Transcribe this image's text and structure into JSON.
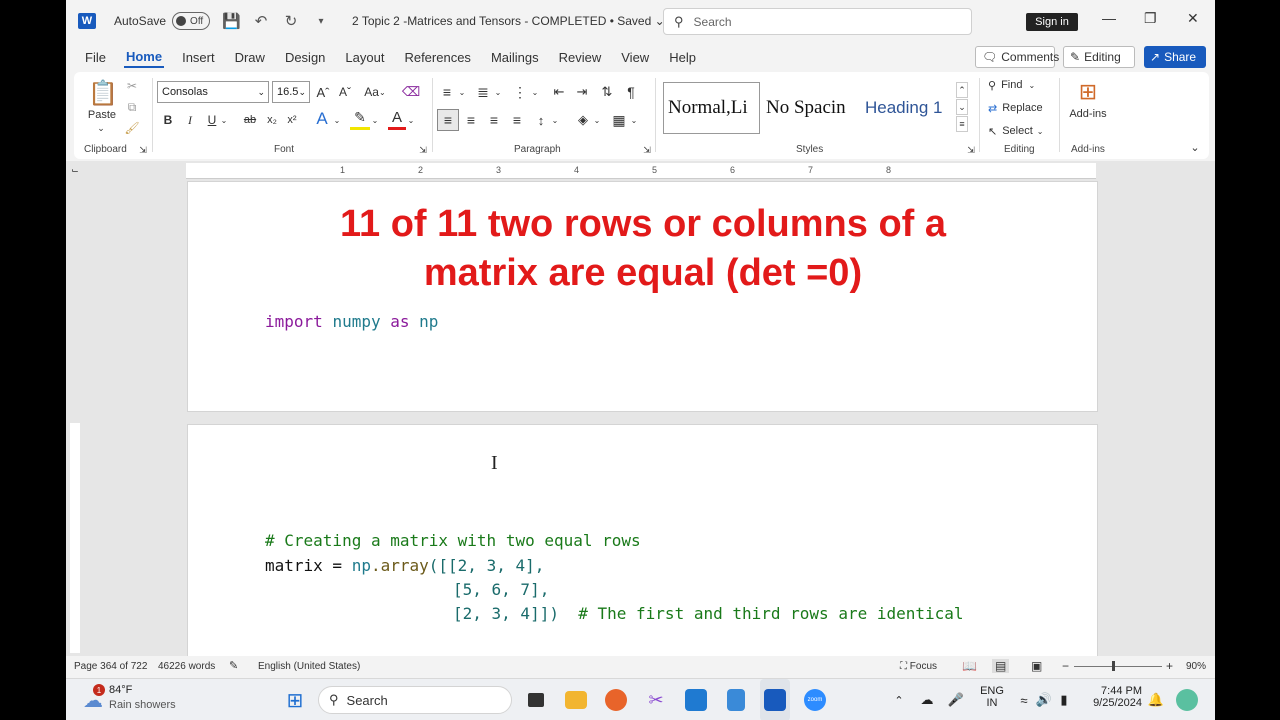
{
  "titlebar": {
    "app_logo": "W",
    "autosave_label": "AutoSave",
    "autosave_state": "Off",
    "doc_title": "2 Topic 2 -Matrices and Tensors - COMPLETED • Saved",
    "search_placeholder": "Search",
    "signin_label": "Sign in"
  },
  "menu": {
    "items": [
      "File",
      "Home",
      "Insert",
      "Draw",
      "Design",
      "Layout",
      "References",
      "Mailings",
      "Review",
      "View",
      "Help"
    ],
    "comments_label": "Comments",
    "editing_label": "Editing",
    "share_label": "Share"
  },
  "ribbon": {
    "clipboard": {
      "paste_label": "Paste",
      "group_label": "Clipboard"
    },
    "font": {
      "family": "Consolas",
      "size": "16.5",
      "case_label": "Aa",
      "group_label": "Font"
    },
    "paragraph": {
      "group_label": "Paragraph"
    },
    "styles": {
      "items": [
        "Normal,Li",
        "No Spacin",
        "Heading 1"
      ],
      "group_label": "Styles"
    },
    "editing": {
      "find_label": "Find",
      "replace_label": "Replace",
      "select_label": "Select",
      "group_label": "Editing"
    },
    "addins": {
      "label": "Add-ins",
      "group_label": "Add-ins"
    }
  },
  "ruler": {
    "marks": [
      "1",
      "2",
      "3",
      "4",
      "5",
      "6",
      "7",
      "8"
    ]
  },
  "document": {
    "heading_line1": "11 of 11 two rows or columns of a",
    "heading_line2": "matrix are equal (det =0)",
    "import_kw": "import",
    "import_mod": "numpy",
    "import_as": "as",
    "import_alias": "np",
    "comment_line": "# Creating a matrix with two equal rows",
    "code_var": "matrix",
    "code_eq": " = ",
    "code_np": "np",
    "code_fn": ".array",
    "row1": "([[2, 3, 4],",
    "row2": "[5, 6, 7],",
    "row3": "[2, 3, 4]])",
    "row3_comment": "# The first and third rows are identical"
  },
  "status": {
    "page": "Page 364 of 722",
    "words": "46226 words",
    "language": "English (United States)",
    "focus": "Focus",
    "zoom": "90%"
  },
  "taskbar": {
    "weather_temp": "84°F",
    "weather_desc": "Rain showers",
    "weather_badge": "1",
    "search_label": "Search",
    "lang_line1": "ENG",
    "lang_line2": "IN",
    "time": "7:44 PM",
    "date": "9/25/2024",
    "zoom_app": "zoom"
  }
}
